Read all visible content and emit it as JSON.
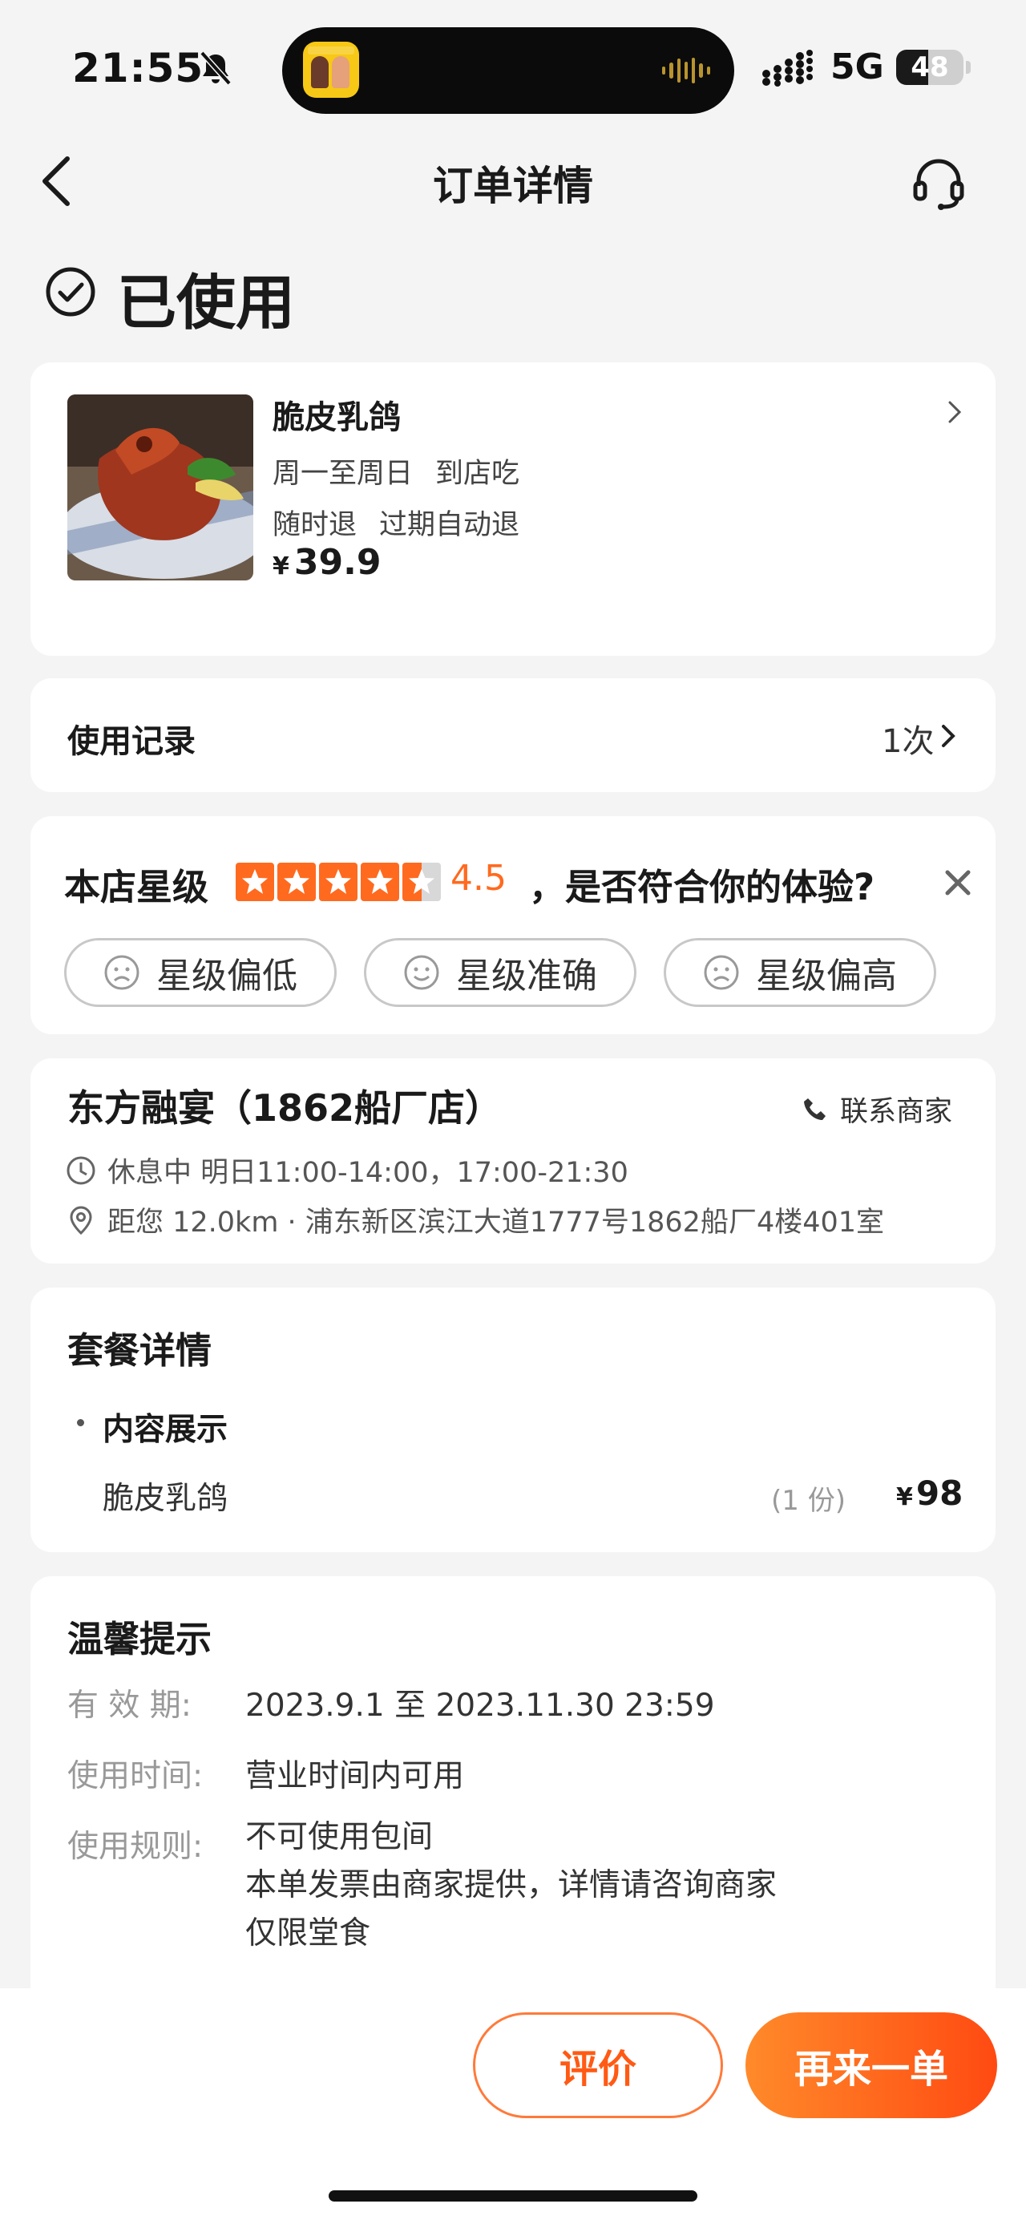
{
  "status_bar": {
    "time": "21:55",
    "network": "5G",
    "battery": "48",
    "battery_level": 0.48,
    "icons": [
      "bell-muted-icon",
      "signal-icon",
      "battery-icon"
    ]
  },
  "nav": {
    "title": "订单详情",
    "icons": [
      "back-chevron-icon",
      "customer-service-icon"
    ]
  },
  "order_status": {
    "label": "已使用",
    "icon": "check-circle-icon"
  },
  "product": {
    "name": "脆皮乳鸽",
    "tags_1": [
      "周一至周日",
      "到店吃"
    ],
    "tags_2": [
      "随时退",
      "过期自动退"
    ],
    "currency": "¥",
    "price": "39.9"
  },
  "usage_record": {
    "label": "使用记录",
    "count": "1次"
  },
  "rating": {
    "label": "本店星级",
    "score": "4.5",
    "score_value": 4.5,
    "question": "，是否符合你的体验?",
    "options": [
      "星级偏低",
      "星级准确",
      "星级偏高"
    ],
    "star_color": "#ff6a1f"
  },
  "store": {
    "name": "东方融宴（1862船厂店）",
    "contact_label": "联系商家",
    "hours": "休息中 明日11:00-14:00，17:00-21:30",
    "location": "距您 12.0km · 浦东新区滨江大道1777号1862船厂4楼401室"
  },
  "package": {
    "title": "套餐详情",
    "section": "内容展示",
    "item_name": "脆皮乳鸽",
    "item_qty": "(1 份)",
    "item_currency": "¥",
    "item_price": "98"
  },
  "tips": {
    "title": "温馨提示",
    "validity_label": "有  效  期:",
    "validity_value": "2023.9.1 至 2023.11.30 23:59",
    "time_label": "使用时间:",
    "time_value": "营业时间内可用",
    "rules_label": "使用规则:",
    "rules": [
      "不可使用包间",
      "本单发票由商家提供，详情请咨询商家",
      "仅限堂食"
    ]
  },
  "actions": {
    "review": "评价",
    "reorder": "再来一单"
  },
  "colors": {
    "accent": "#ff5a14",
    "background": "#f4f4f4"
  }
}
